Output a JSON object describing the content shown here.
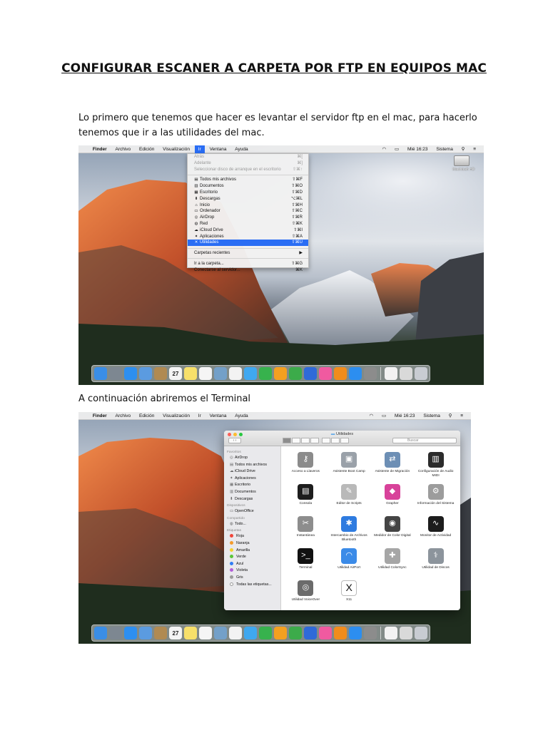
{
  "document": {
    "title": "CONFIGURAR ESCANER A CARPETA POR FTP EN EQUIPOS  MAC",
    "paragraph1": "Lo primero que tenemos que hacer es levantar el servidor ftp en el mac, para hacerlo tenemos que ir a las utilidades del mac.",
    "paragraph2": "A continuación abriremos el Terminal"
  },
  "screenshot1": {
    "menubar": {
      "apple": "",
      "items": [
        "Finder",
        "Archivo",
        "Edición",
        "Visualización",
        "Ir",
        "Ventana",
        "Ayuda"
      ],
      "active": "Ir",
      "clock": "Mié 16:23",
      "user": "Sistema"
    },
    "desktop_disk_label": "Macintosh HD",
    "go_menu": [
      {
        "label": "Atrás",
        "shortcut": "⌘[",
        "disabled": true
      },
      {
        "label": "Adelante",
        "shortcut": "⌘]",
        "disabled": true
      },
      {
        "label": "Seleccionar disco de arranque en el escritorio",
        "shortcut": "⇧⌘↑",
        "disabled": true
      },
      {
        "separator": true
      },
      {
        "label": "Todos mis archivos",
        "shortcut": "⇧⌘F",
        "icon": "files-icon"
      },
      {
        "label": "Documentos",
        "shortcut": "⇧⌘O",
        "icon": "documents-icon"
      },
      {
        "label": "Escritorio",
        "shortcut": "⇧⌘D",
        "icon": "desktop-icon"
      },
      {
        "label": "Descargas",
        "shortcut": "⌥⌘L",
        "icon": "downloads-icon"
      },
      {
        "label": "Inicio",
        "shortcut": "⇧⌘H",
        "icon": "home-icon"
      },
      {
        "label": "Ordenador",
        "shortcut": "⇧⌘C",
        "icon": "computer-icon"
      },
      {
        "label": "AirDrop",
        "shortcut": "⇧⌘R",
        "icon": "airdrop-icon"
      },
      {
        "label": "Red",
        "shortcut": "⇧⌘K",
        "icon": "network-icon"
      },
      {
        "label": "iCloud Drive",
        "shortcut": "⇧⌘I",
        "icon": "icloud-icon"
      },
      {
        "label": "Aplicaciones",
        "shortcut": "⇧⌘A",
        "icon": "applications-icon"
      },
      {
        "label": "Utilidades",
        "shortcut": "⇧⌘U",
        "icon": "utilities-icon",
        "highlighted": true
      },
      {
        "separator": true
      },
      {
        "label": "Carpetas recientes",
        "shortcut": "▶"
      },
      {
        "separator": true
      },
      {
        "label": "Ir a la carpeta...",
        "shortcut": "⇧⌘G"
      },
      {
        "label": "Conectarse al servidor...",
        "shortcut": "⌘K"
      }
    ]
  },
  "screenshot2": {
    "menubar": {
      "apple": "",
      "items": [
        "Finder",
        "Archivo",
        "Edición",
        "Visualización",
        "Ir",
        "Ventana",
        "Ayuda"
      ],
      "clock": "Mié 16:23",
      "user": "Sistema"
    },
    "window": {
      "title": "Utilidades",
      "search_placeholder": "Buscar",
      "sidebar": {
        "favorites_header": "Favoritos",
        "favorites": [
          "AirDrop",
          "Todos mis archivos",
          "iCloud Drive",
          "Aplicaciones",
          "Escritorio",
          "Documentos",
          "Descargas"
        ],
        "devices_header": "Dispositivos",
        "devices": [
          "OpenOffice"
        ],
        "shared_header": "Compartido",
        "shared": [
          "Todo..."
        ],
        "tags_header": "Etiquetas",
        "tags": [
          {
            "label": "Roja",
            "color": "#f0453a"
          },
          {
            "label": "Naranja",
            "color": "#f59b2b"
          },
          {
            "label": "Amarilla",
            "color": "#f5d12f"
          },
          {
            "label": "Verde",
            "color": "#5ac53a"
          },
          {
            "label": "Azul",
            "color": "#2f7df5"
          },
          {
            "label": "Violeta",
            "color": "#b25fd8"
          },
          {
            "label": "Gris",
            "color": "#9b9b9b"
          },
          {
            "label": "Todas las etiquetas...",
            "color": ""
          }
        ]
      },
      "apps": [
        {
          "label": "Acceso a Llaveros",
          "icon": "keychain-icon",
          "color": "#8b8b8b"
        },
        {
          "label": "Asistente Boot Camp",
          "icon": "bootcamp-icon",
          "color": "#9aa1a9"
        },
        {
          "label": "Asistente de Migración",
          "icon": "migration-icon",
          "color": "#6d8fb5"
        },
        {
          "label": "Configuración de Audio MIDI",
          "icon": "midi-icon",
          "color": "#2b2b2b"
        },
        {
          "label": "Consola",
          "icon": "console-icon",
          "color": "#1d1d1d"
        },
        {
          "label": "Editor de Scripts",
          "icon": "script-editor-icon",
          "color": "#b9b9b9"
        },
        {
          "label": "Grapher",
          "icon": "grapher-icon",
          "color": "#d8429a"
        },
        {
          "label": "Información del Sistema",
          "icon": "system-info-icon",
          "color": "#9c9c9c"
        },
        {
          "label": "Instantánea",
          "icon": "grab-icon",
          "color": "#8d8d8d"
        },
        {
          "label": "Intercambio de Archivos Bluetooth",
          "icon": "bluetooth-icon",
          "color": "#2e7be0"
        },
        {
          "label": "Medidor de Color Digital",
          "icon": "color-meter-icon",
          "color": "#444444"
        },
        {
          "label": "Monitor de Actividad",
          "icon": "activity-monitor-icon",
          "color": "#1c1c1c"
        },
        {
          "label": "Terminal",
          "icon": "terminal-icon",
          "color": "#111111"
        },
        {
          "label": "Utilidad AirPort",
          "icon": "airport-icon",
          "color": "#3b8be8"
        },
        {
          "label": "Utilidad ColorSync",
          "icon": "colorsync-icon",
          "color": "#a6a6a6"
        },
        {
          "label": "Utilidad de Discos",
          "icon": "disk-utility-icon",
          "color": "#8c949c"
        },
        {
          "label": "Utilidad VoiceOver",
          "icon": "voiceover-icon",
          "color": "#6b6b6b"
        },
        {
          "label": "X11",
          "icon": "x11-icon",
          "color": "#ffffff"
        }
      ]
    }
  },
  "dock_apps": [
    {
      "icon": "finder-icon",
      "color": "#3a8ee6"
    },
    {
      "icon": "launchpad-icon",
      "color": "#7d8791"
    },
    {
      "icon": "safari-icon",
      "color": "#2d8ff0"
    },
    {
      "icon": "mail-icon",
      "color": "#5b9be0"
    },
    {
      "icon": "contacts-icon",
      "color": "#b08a52"
    },
    {
      "icon": "calendar-icon",
      "color": "#f4f4f4"
    },
    {
      "icon": "notes-icon",
      "color": "#f7e06a"
    },
    {
      "icon": "reminders-icon",
      "color": "#f5f5f5"
    },
    {
      "icon": "preview-icon",
      "color": "#73a0c8"
    },
    {
      "icon": "photos-icon",
      "color": "#f3f3f3"
    },
    {
      "icon": "messages-icon",
      "color": "#3fa8f0"
    },
    {
      "icon": "facetime-icon",
      "color": "#37b24d"
    },
    {
      "icon": "pages-icon",
      "color": "#f4a020"
    },
    {
      "icon": "numbers-icon",
      "color": "#3cab4a"
    },
    {
      "icon": "keynote-icon",
      "color": "#2f6ad8"
    },
    {
      "icon": "itunes-icon",
      "color": "#f05aa0"
    },
    {
      "icon": "ibooks-icon",
      "color": "#f08c1c"
    },
    {
      "icon": "appstore-icon",
      "color": "#2c8ef0"
    },
    {
      "icon": "system-preferences-icon",
      "color": "#8c8c8c"
    },
    {
      "icon": "document-icon",
      "color": "#f2f2f2"
    },
    {
      "icon": "stack-icon",
      "color": "#d9d9d9"
    },
    {
      "icon": "trash-icon",
      "color": "#c8ccd2"
    }
  ],
  "dock_glyphs": {
    "calendar-icon": "27"
  }
}
